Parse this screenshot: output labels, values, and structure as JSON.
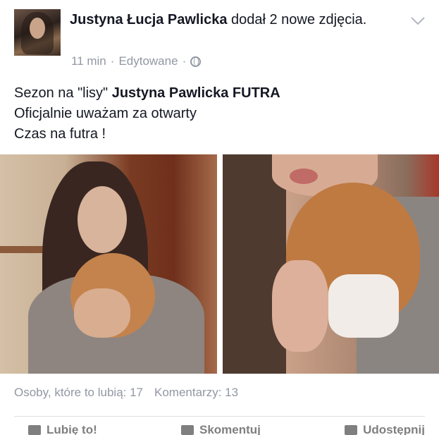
{
  "post": {
    "author": "Justyna Łucja Pawlicka",
    "action": "dodał 2 nowe zdjęcia.",
    "time": "11 min",
    "edited": "Edytowane",
    "separator": "·",
    "audience_icon": "globe-icon",
    "menu_icon": "chevron-down-icon",
    "text_line1_prefix": "Sezon na \"lisy\"",
    "text_line1_tag": "Justyna Pawlicka FUTRA",
    "text_line2": "Oficjalnie uważam za otwarty",
    "text_line3": "Czas na futra !"
  },
  "stats": {
    "likes": "Osoby, które to lubią: 17",
    "comments": "Komentarzy: 13"
  },
  "actions": [
    {
      "label": "Lubię to!",
      "icon": "like-icon"
    },
    {
      "label": "Skomentuj",
      "icon": "comment-icon"
    },
    {
      "label": "Udostępnij",
      "icon": "share-icon"
    }
  ],
  "colors": {
    "text": "#141823",
    "meta": "#9197a3",
    "divider": "#dddfe2"
  }
}
